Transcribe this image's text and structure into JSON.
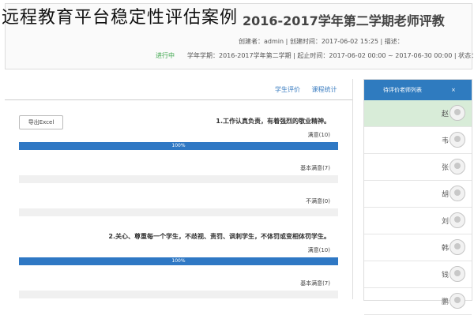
{
  "caption": "远程教育平台稳定性评估案例",
  "header": {
    "title": "2016-2017学年第二学期老师评教",
    "meta": "创建者：admin | 创建时间：2017-06-02 15:25 | 描述：",
    "meta2": "学年学期：2016-2017学年第二学期 | 起止时间：2017-06-02 00:00 ~ 2017-06-30 00:00 | 状态：",
    "state": "进行中",
    "left_state": "进行中"
  },
  "tabs": [
    "学生评价",
    "课程统计"
  ],
  "export_label": "导出Excel",
  "questions": [
    {
      "title": "1.工作认真负责，有着强烈的敬业精神。",
      "options": [
        {
          "label": "满意(10)",
          "percent": 100,
          "percent_label": "100%"
        },
        {
          "label": "基本满意(7)",
          "percent": 0,
          "percent_label": ""
        },
        {
          "label": "不满意(0)",
          "percent": 0,
          "percent_label": ""
        }
      ]
    },
    {
      "title": "2.关心、尊重每一个学生，不歧视、责罚、讽刺学生，不体罚或变相体罚学生。",
      "options": [
        {
          "label": "满意(10)",
          "percent": 100,
          "percent_label": "100%"
        },
        {
          "label": "基本满意(7)",
          "percent": 0,
          "percent_label": ""
        }
      ]
    }
  ],
  "sidebar": {
    "title": "待评价老师列表",
    "close": "×",
    "items": [
      {
        "name": "赵",
        "active": true
      },
      {
        "name": "韦",
        "active": false
      },
      {
        "name": "张",
        "active": false
      },
      {
        "name": "胡",
        "active": false
      },
      {
        "name": "刘",
        "active": false
      },
      {
        "name": "韩",
        "active": false
      },
      {
        "name": "钱",
        "active": false
      },
      {
        "name": "鹏",
        "active": false
      }
    ]
  }
}
